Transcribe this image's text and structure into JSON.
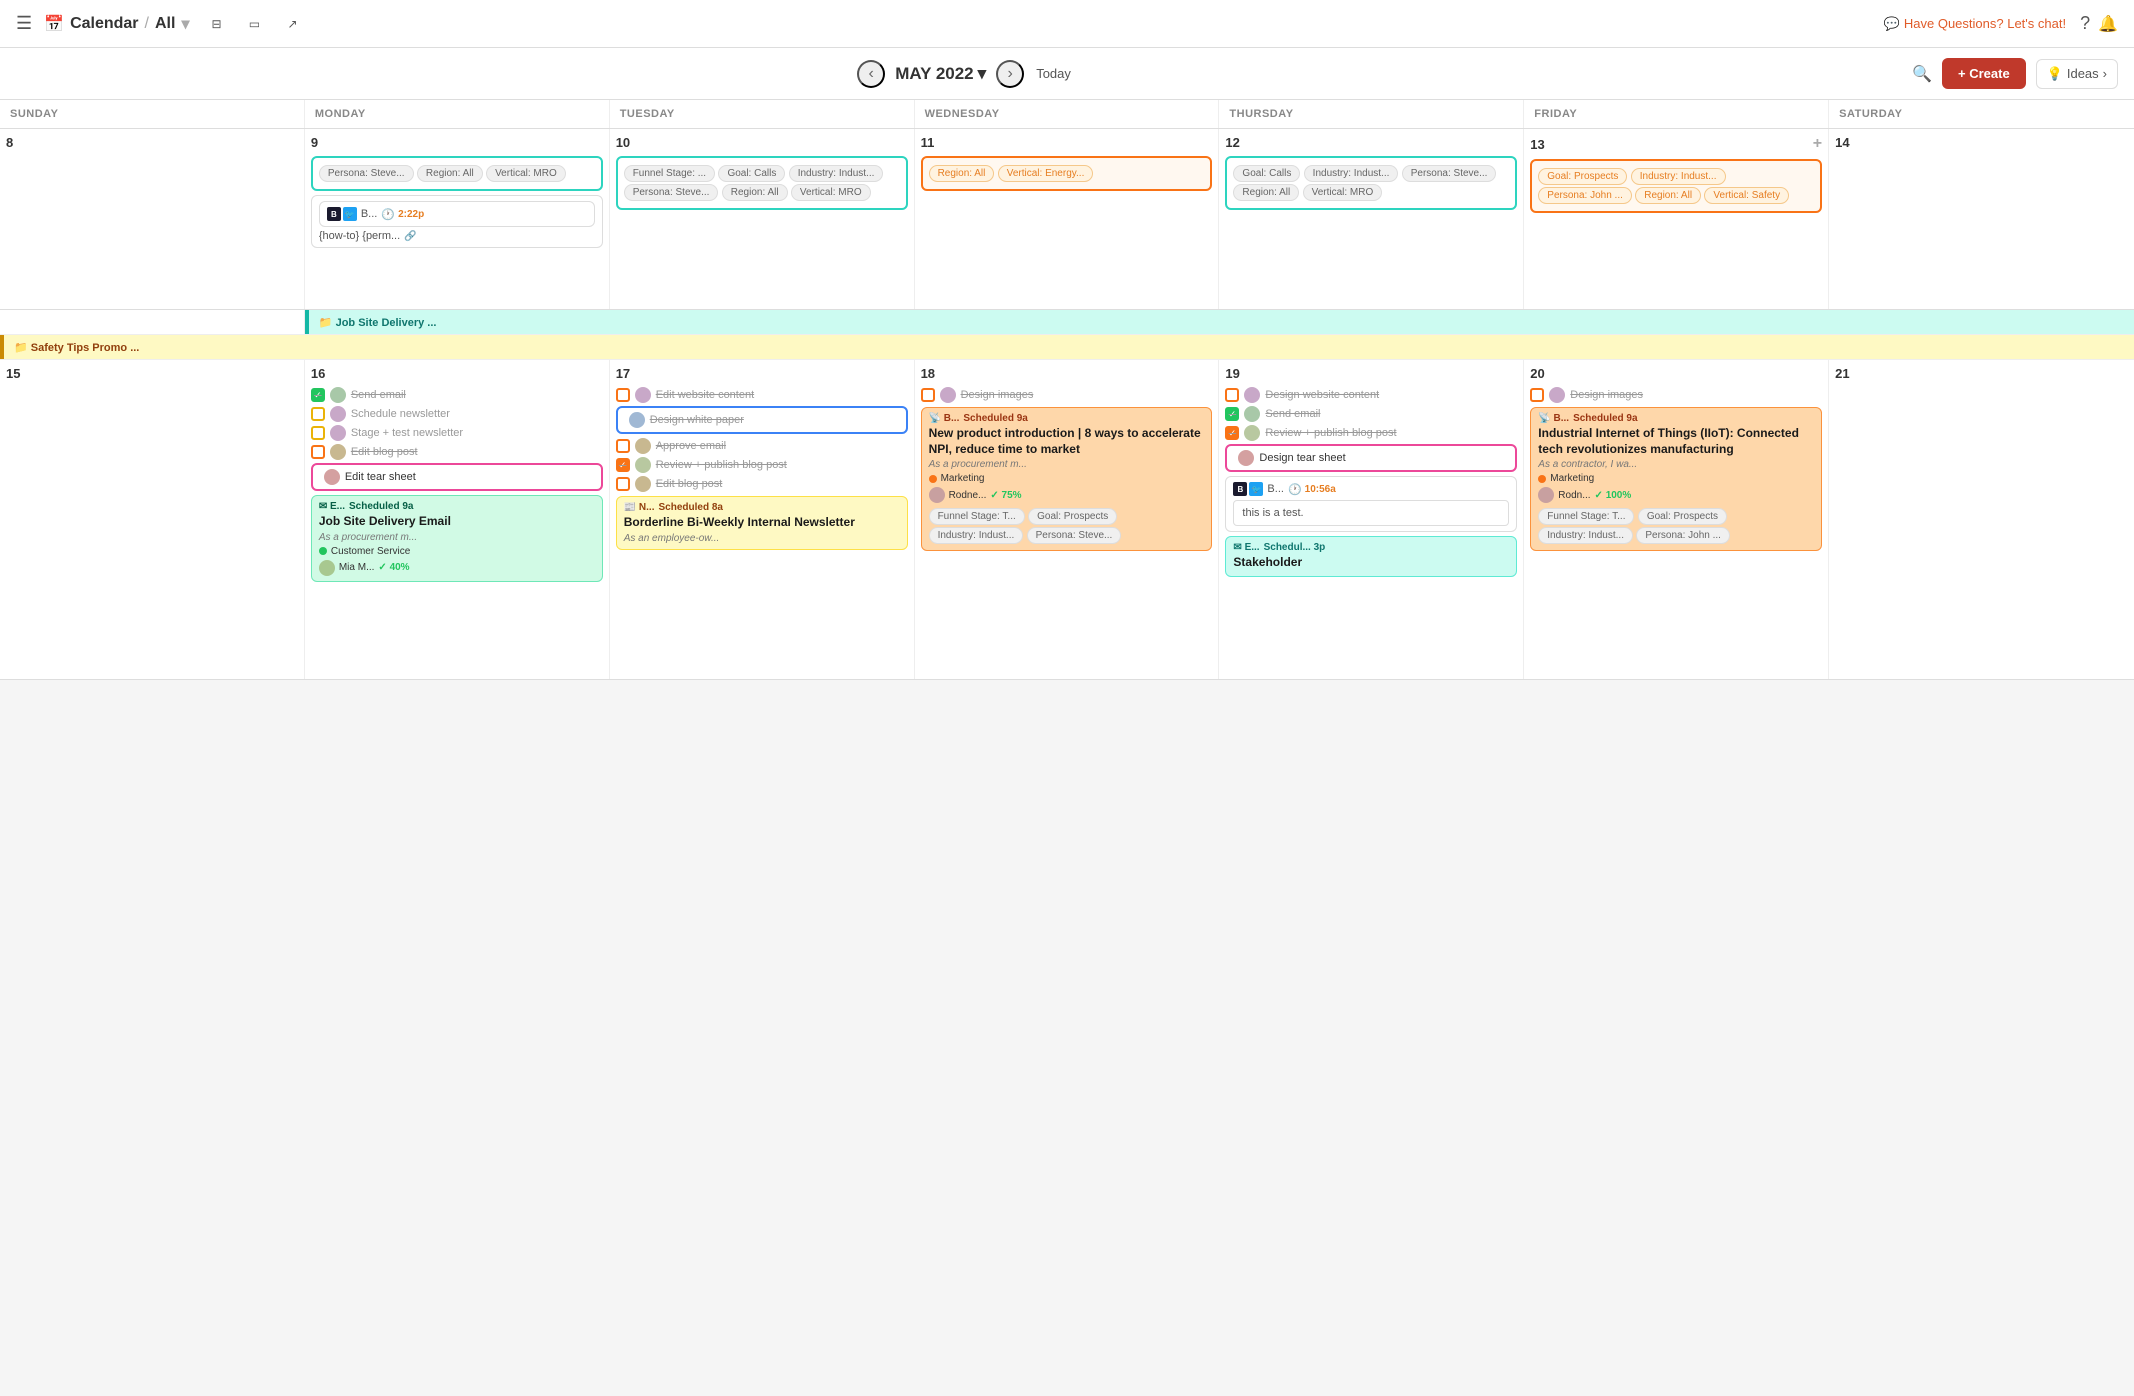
{
  "topNav": {
    "title": "Calendar",
    "separator": "/",
    "view": "All",
    "helpChat": "Have Questions? Let's chat!",
    "hamburgerIcon": "☰",
    "calendarIcon": "📅",
    "chevronDownIcon": "▾",
    "filterIcon": "⊟",
    "monitorIcon": "□",
    "shareIcon": "↗"
  },
  "calToolbar": {
    "prevIcon": "‹",
    "nextIcon": "›",
    "monthTitle": "MAY 2022",
    "chevronDown": "▾",
    "today": "Today",
    "searchIcon": "🔍",
    "createLabel": "+ Create",
    "ideasIcon": "💡",
    "ideasLabel": "Ideas",
    "ideasChevron": "›"
  },
  "dayHeaders": [
    "SUNDAY",
    "MONDAY",
    "TUESDAY",
    "WEDNESDAY",
    "THURSDAY",
    "FRIDAY",
    "SATURDAY"
  ],
  "week1": {
    "days": [
      {
        "number": "8",
        "dayName": "sun",
        "events": []
      },
      {
        "number": "9",
        "dayName": "mon",
        "tagGroup": {
          "pills": [
            "Persona: Steve...",
            "Region: All",
            "Vertical: MRO"
          ]
        },
        "socialCard": {
          "labels": [
            "B...",
            "2:22p"
          ],
          "body": "{how-to} {perm..."
        }
      },
      {
        "number": "10",
        "dayName": "tue",
        "tagGroup": {
          "pills": [
            "Funnel Stage: ...",
            "Goal: Calls",
            "Industry: Indust...",
            "Persona: Steve...",
            "Region: All",
            "Vertical: MRO"
          ]
        }
      },
      {
        "number": "11",
        "dayName": "wed",
        "tagGroup": {
          "pills": [
            "Region: All",
            "Vertical: Energy..."
          ],
          "style": "orange"
        }
      },
      {
        "number": "12",
        "dayName": "thu",
        "tagGroup": {
          "pills": [
            "Goal: Calls",
            "Industry: Indust...",
            "Persona: Steve...",
            "Region: All",
            "Vertical: MRO"
          ]
        }
      },
      {
        "number": "13",
        "dayName": "fri",
        "plusIcon": "+",
        "tagGroup": {
          "pills": [
            "Goal: Prospects",
            "Industry: Indust...",
            "Persona: John ...",
            "Region: All",
            "Vertical: Safety"
          ],
          "style": "orange"
        }
      },
      {
        "number": "14",
        "dayName": "sat",
        "events": []
      }
    ]
  },
  "bannerRow1": {
    "label": "📁 Job Site Delivery ...",
    "style": "teal",
    "startCol": 2,
    "span": 6
  },
  "bannerRow2": {
    "label": "📁 Safety Tips Promo ...",
    "style": "yellow"
  },
  "week2": {
    "days": [
      {
        "number": "15",
        "dayName": "sun",
        "events": []
      },
      {
        "number": "16",
        "dayName": "mon",
        "tasks": [
          {
            "label": "Send email",
            "state": "checked",
            "hasAvatar": true
          },
          {
            "label": "Schedule newsletter",
            "state": "yellow",
            "hasAvatar": true
          },
          {
            "label": "Stage + test newsletter",
            "state": "yellow",
            "hasAvatar": true
          },
          {
            "label": "Edit blog post",
            "state": "orange",
            "hasAvatar": true,
            "strikethrough": true
          },
          {
            "label": "Edit tear sheet",
            "state": "pink",
            "hasAvatar": true,
            "highlighted": true
          }
        ],
        "scheduledCard": {
          "prefix": "E...",
          "time": "Scheduled 9a",
          "title": "Job Site Delivery Email",
          "subtitle": "As a procurement m...",
          "dotColor": "green",
          "dotLabel": "Customer Service",
          "avatar": "Mia M...",
          "percent": "40%"
        }
      },
      {
        "number": "17",
        "dayName": "tue",
        "tasks": [
          {
            "label": "Edit website content",
            "state": "orange",
            "hasAvatar": true,
            "strikethrough": true
          },
          {
            "label": "Design white paper",
            "state": "blue",
            "hasAvatar": true,
            "highlighted": true,
            "strikethrough": true
          },
          {
            "label": "Approve email",
            "state": "orange",
            "hasAvatar": true,
            "strikethrough": true
          },
          {
            "label": "Review + publish blog post",
            "state": "checked-orange",
            "hasAvatar": true,
            "strikethrough": true
          },
          {
            "label": "Edit blog post",
            "state": "orange",
            "hasAvatar": true,
            "strikethrough": true
          }
        ],
        "scheduledCard": {
          "prefix": "N...",
          "time": "Scheduled 8a",
          "title": "Borderline Bi-Weekly Internal Newsletter",
          "subtitle": "As an employee-ow...",
          "dotColor": null
        }
      },
      {
        "number": "18",
        "dayName": "wed",
        "tasks": [
          {
            "label": "Design images",
            "state": "orange",
            "hasAvatar": true,
            "strikethrough": true
          }
        ],
        "scheduledCard": {
          "prefix": "B...",
          "time": "Scheduled 9a",
          "title": "New product introduction | 8 ways to accelerate NPI, reduce time to market",
          "subtitle": "As a procurement m...",
          "dotColor": "orange",
          "dotLabel": "Marketing",
          "avatar": "Rodne...",
          "percent": "75%",
          "tags": [
            "Funnel Stage: T...",
            "Goal: Prospects",
            "Industry: Indust...",
            "Persona: Steve..."
          ]
        }
      },
      {
        "number": "19",
        "dayName": "thu",
        "tasks": [
          {
            "label": "Design website content",
            "state": "orange",
            "hasAvatar": true,
            "strikethrough": true
          },
          {
            "label": "Send email",
            "state": "checked",
            "hasAvatar": true
          },
          {
            "label": "Review + publish blog post",
            "state": "checked-orange",
            "hasAvatar": true,
            "strikethrough": true
          }
        ],
        "tearSheet": {
          "label": "Design tear sheet",
          "highlighted": true
        },
        "socialCard2": {
          "labels": [
            "B...",
            "10:56a"
          ],
          "body": "this is a test."
        },
        "scheduledCard": {
          "prefix": "E...",
          "time": "Schedul... 3p",
          "title": "Stakeholder",
          "subtitle": ""
        }
      },
      {
        "number": "20",
        "dayName": "fri",
        "tasks": [
          {
            "label": "Design images",
            "state": "orange",
            "hasAvatar": true,
            "strikethrough": true
          }
        ],
        "scheduledCard": {
          "prefix": "B...",
          "time": "Scheduled 9a",
          "title": "Industrial Internet of Things (IIoT): Connected tech revolutionizes manufacturing",
          "subtitle": "As a contractor, I wa...",
          "dotColor": "orange",
          "dotLabel": "Marketing",
          "avatar": "Rodn...",
          "percent": "100%",
          "tags": [
            "Funnel Stage: T...",
            "Goal: Prospects",
            "Industry: Indust...",
            "Persona: John ..."
          ]
        }
      },
      {
        "number": "21",
        "dayName": "sat",
        "events": []
      }
    ]
  },
  "colors": {
    "teal": "#14b8a6",
    "orange": "#f97316",
    "yellow": "#ca8a04",
    "pink": "#ec4899",
    "blue": "#3b82f6",
    "green": "#22c55e",
    "red": "#c0392b"
  }
}
